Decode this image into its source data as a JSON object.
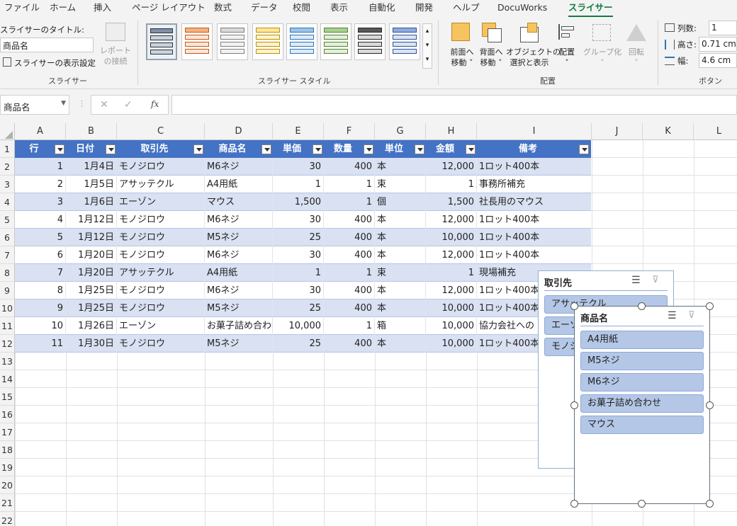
{
  "ribbon_tabs": [
    "ファイル",
    "ホーム",
    "挿入",
    "ページ レイアウト",
    "数式",
    "データ",
    "校閲",
    "表示",
    "自動化",
    "開発",
    "ヘルプ",
    "DocuWorks",
    "スライサー"
  ],
  "ribbon": {
    "slicer_title_label": "スライサーのタイトル:",
    "slicer_title_value": "商品名",
    "display_settings": "スライサーの表示設定",
    "report_conn_1": "レポート",
    "report_conn_2": "の接続",
    "group_slicer": "スライサー",
    "group_styles": "スライサー スタイル",
    "bring_forward_1": "前面へ",
    "bring_forward_2": "移動 ˅",
    "send_backward_1": "背面へ",
    "send_backward_2": "移動 ˅",
    "selection_pane_1": "オブジェクトの",
    "selection_pane_2": "選択と表示",
    "align": "配置",
    "group_btn": "グループ化",
    "rotate": "回転",
    "group_arrange": "配置",
    "columns_label": "列数:",
    "columns_value": "1",
    "height_label": "高さ:",
    "height_value": "0.71 cm",
    "width_label": "幅:",
    "width_value": "4.6 cm",
    "group_buttons": "ボタン"
  },
  "formula_bar": {
    "name_box": "商品名",
    "formula": ""
  },
  "column_headers": [
    "A",
    "B",
    "C",
    "D",
    "E",
    "F",
    "G",
    "H",
    "I",
    "J",
    "K",
    "L"
  ],
  "row_headers": [
    "1",
    "2",
    "3",
    "4",
    "5",
    "6",
    "7",
    "8",
    "9",
    "10",
    "11",
    "12",
    "13",
    "14",
    "15",
    "16",
    "17",
    "18",
    "19",
    "20",
    "21",
    "22"
  ],
  "table": {
    "headers": [
      "行",
      "日付",
      "取引先",
      "商品名",
      "単価",
      "数量",
      "単位",
      "金額",
      "備考"
    ],
    "rows": [
      [
        "1",
        "1月4日",
        "モノジロウ",
        "M6ネジ",
        "30",
        "400",
        "本",
        "12,000",
        "1ロット400本"
      ],
      [
        "2",
        "1月5日",
        "アサッテクル",
        "A4用紙",
        "1",
        "1",
        "束",
        "1",
        "事務所補充"
      ],
      [
        "3",
        "1月6日",
        "エーゾン",
        "マウス",
        "1,500",
        "1",
        "個",
        "1,500",
        "社長用のマウス"
      ],
      [
        "4",
        "1月12日",
        "モノジロウ",
        "M6ネジ",
        "30",
        "400",
        "本",
        "12,000",
        "1ロット400本"
      ],
      [
        "5",
        "1月12日",
        "モノジロウ",
        "M5ネジ",
        "25",
        "400",
        "本",
        "10,000",
        "1ロット400本"
      ],
      [
        "6",
        "1月20日",
        "モノジロウ",
        "M6ネジ",
        "30",
        "400",
        "本",
        "12,000",
        "1ロット400本"
      ],
      [
        "7",
        "1月20日",
        "アサッテクル",
        "A4用紙",
        "1",
        "1",
        "束",
        "1",
        "現場補充"
      ],
      [
        "8",
        "1月25日",
        "モノジロウ",
        "M6ネジ",
        "30",
        "400",
        "本",
        "12,000",
        "1ロット400本"
      ],
      [
        "9",
        "1月25日",
        "モノジロウ",
        "M5ネジ",
        "25",
        "400",
        "本",
        "10,000",
        "1ロット400本"
      ],
      [
        "10",
        "1月26日",
        "エーゾン",
        "お菓子詰め合わせ",
        "10,000",
        "1",
        "箱",
        "10,000",
        "協力会社への"
      ],
      [
        "11",
        "1月30日",
        "モノジロウ",
        "M5ネジ",
        "25",
        "400",
        "本",
        "10,000",
        "1ロット400本"
      ]
    ]
  },
  "slicer_vendor": {
    "title": "取引先",
    "items": [
      "アサッテクル",
      "エーゾン",
      "モノジロウ"
    ]
  },
  "slicer_product": {
    "title": "商品名",
    "items": [
      "A4用紙",
      "M5ネジ",
      "M6ネジ",
      "お菓子詰め合わせ",
      "マウス"
    ]
  },
  "colors": {
    "accent": "#107c41",
    "table_header": "#4472c4",
    "band": "#d9e1f2",
    "slicer_item": "#b4c7e7"
  }
}
